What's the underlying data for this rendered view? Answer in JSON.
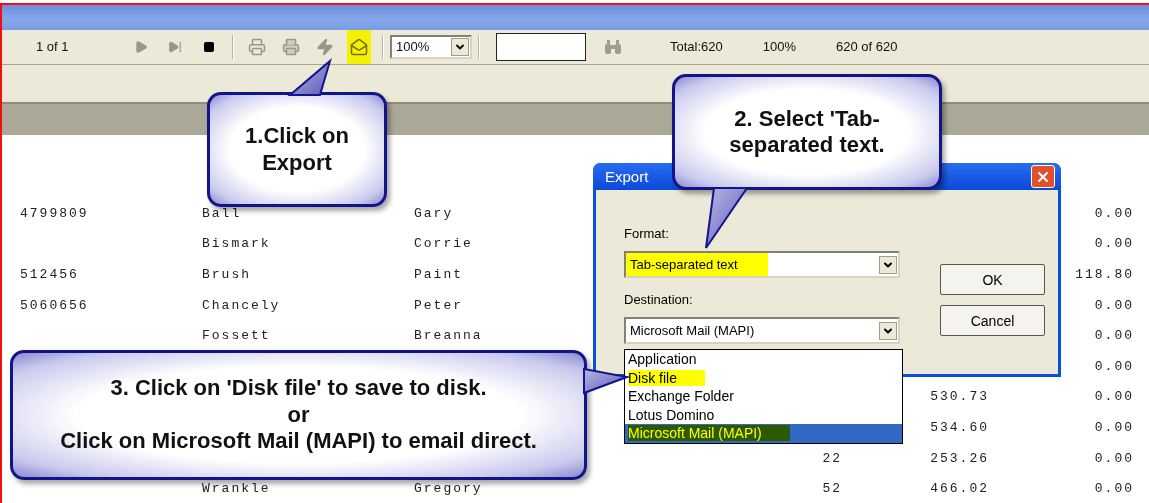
{
  "toolbar": {
    "page_indicator": "1 of 1",
    "nav_buttons": [
      {
        "kind": "next",
        "disabled": true
      },
      {
        "kind": "last",
        "disabled": true
      },
      {
        "kind": "stop",
        "disabled": false
      }
    ],
    "tool_buttons": [
      {
        "kind": "print",
        "disabled": true,
        "highlighted": false
      },
      {
        "kind": "printer-setup",
        "disabled": true,
        "highlighted": false
      },
      {
        "kind": "refresh",
        "disabled": true,
        "highlighted": false
      },
      {
        "kind": "export",
        "disabled": false,
        "highlighted": true
      }
    ],
    "zoom": {
      "value": "100%"
    },
    "find_button": {
      "disabled": true
    },
    "stats": [
      "Total:620",
      "100%",
      "620 of 620"
    ]
  },
  "report": {
    "rows": [
      {
        "column_1": "4799809",
        "column_2": "Ball",
        "column_3": "Gary",
        "column_6": "0.00"
      },
      {
        "column_2": "Bismark",
        "column_3": "Corrie",
        "column_6": "0.00"
      },
      {
        "column_1": "512456",
        "column_2": "Brush",
        "column_3": "Paint",
        "column_6": "118.80"
      },
      {
        "column_1": "5060656",
        "column_2": "Chancely",
        "column_3": "Peter",
        "column_6": "0.00"
      },
      {
        "column_2": "Fossett",
        "column_3": "Breanna",
        "column_6": "0.00"
      },
      {
        "column_6": "0.00"
      },
      {
        "column_5": "530.73",
        "column_6": "0.00"
      },
      {
        "column_5": "534.60",
        "column_6": "0.00"
      },
      {
        "column_4": "22",
        "column_5": "253.26",
        "column_6": "0.00"
      },
      {
        "column_2": "Wrankle",
        "column_3": "Gregory",
        "column_4": "52",
        "column_5": "466.02",
        "column_6": "0.00"
      }
    ]
  },
  "export_dialog": {
    "title": "Export",
    "format_label": "Format:",
    "format_value": "Tab-separated text",
    "format_highlighted": true,
    "destination_label": "Destination:",
    "destination_value": "Microsoft Mail (MAPI)",
    "destination_options": [
      {
        "label": "Application",
        "selected": false,
        "highlighted": false
      },
      {
        "label": "Disk file",
        "selected": false,
        "highlighted": true
      },
      {
        "label": "Exchange Folder",
        "selected": false,
        "highlighted": false
      },
      {
        "label": "Lotus Domino",
        "selected": false,
        "highlighted": false
      },
      {
        "label": "Microsoft Mail (MAPI)",
        "selected": true,
        "highlighted": true
      }
    ],
    "buttons": [
      "OK",
      "Cancel"
    ]
  },
  "callouts": [
    {
      "kind": "export",
      "lines": [
        "1.Click on Export"
      ]
    },
    {
      "kind": "format",
      "lines": [
        "2. Select 'Tab-separated text."
      ]
    },
    {
      "kind": "destination",
      "lines": [
        "3. Click on 'Disk file' to save to disk.",
        "or",
        "Click on Microsoft Mail (MAPI) to email direct."
      ]
    }
  ]
}
